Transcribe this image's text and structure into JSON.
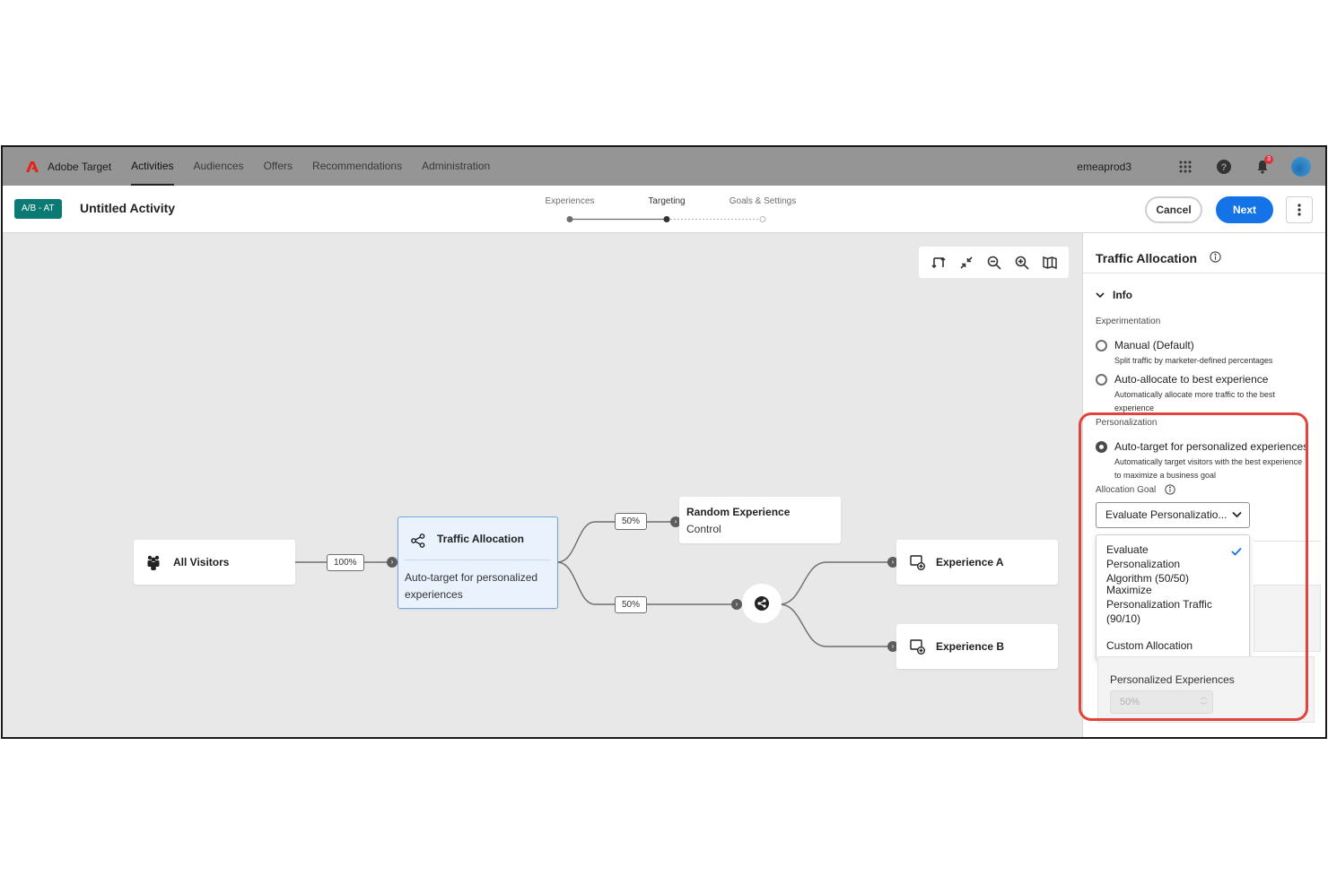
{
  "topnav": {
    "brand": "Adobe Target",
    "items": [
      "Activities",
      "Audiences",
      "Offers",
      "Recommendations",
      "Administration"
    ],
    "active_index": 0,
    "org": "emeaprod3",
    "notification_count": "3",
    "icons": [
      "adobe-logo-icon",
      "apps-grid-icon",
      "help-icon",
      "bell-icon",
      "avatar"
    ]
  },
  "activity": {
    "type_badge": "A/B - AT",
    "title": "Untitled Activity",
    "steps": [
      {
        "label": "Experiences",
        "state": "done"
      },
      {
        "label": "Targeting",
        "state": "current"
      },
      {
        "label": "Goals & Settings",
        "state": "upcoming"
      }
    ],
    "cancel_label": "Cancel",
    "next_label": "Next"
  },
  "canvas": {
    "toolbar_icons": [
      "swap-layout-icon",
      "collapse-icon",
      "zoom-out-icon",
      "zoom-in-icon",
      "minimap-icon"
    ],
    "nodes": {
      "all_visitors": "All Visitors",
      "traffic_allocation_title": "Traffic Allocation",
      "traffic_allocation_desc": "Auto-target for personalized experiences",
      "random_experience_title": "Random Experience",
      "random_experience_sub": "Control",
      "experience_a": "Experience A",
      "experience_b": "Experience B"
    },
    "edge_labels": {
      "visitors_to_allocation": "100%",
      "to_random": "50%",
      "to_personalized": "50%"
    }
  },
  "panel": {
    "title": "Traffic Allocation",
    "info_label": "Info",
    "experimentation_label": "Experimentation",
    "options": [
      {
        "label": "Manual (Default)",
        "desc": "Split traffic by marketer-defined percentages",
        "checked": false
      },
      {
        "label": "Auto-allocate to best experience",
        "desc": "Automatically allocate more traffic to the best experience",
        "checked": false
      }
    ],
    "personalization_label": "Personalization",
    "personalization_option": {
      "label": "Auto-target for personalized experiences",
      "desc": "Automatically target visitors with the best experience to maximize a business goal",
      "checked": true
    },
    "allocation_goal_label": "Allocation Goal",
    "allocation_goal_value": "Evaluate Personalizatio...",
    "goal_menu": [
      {
        "label": "Evaluate Personalization Algorithm (50/50)",
        "selected": true
      },
      {
        "label": "Maximize Personalization Traffic (90/10)",
        "selected": false
      },
      {
        "label": "Custom Allocation",
        "selected": false
      }
    ],
    "personalized_experiences_label": "Personalized Experiences",
    "personalized_experiences_value": "50%"
  },
  "colors": {
    "accent_blue": "#1473e6",
    "badge_teal": "#0a7a72",
    "highlight_red": "#e0443c",
    "adobe_red": "#e1251b"
  }
}
